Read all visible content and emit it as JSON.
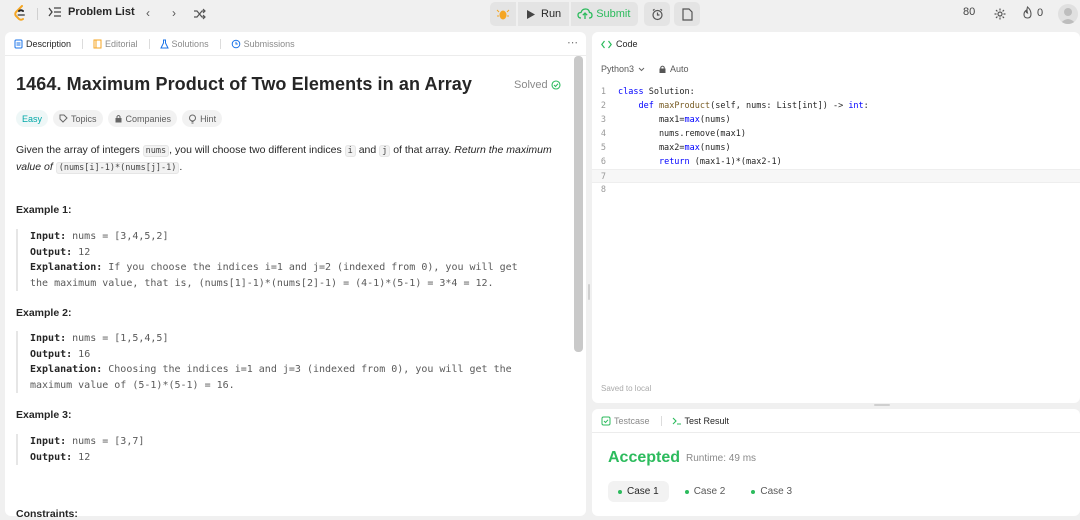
{
  "topbar": {
    "title": "Problem List",
    "run_label": "Run",
    "submit_label": "Submit",
    "points": "80",
    "streak": "0",
    "accent": "#2cbb5d"
  },
  "left_tabs": [
    {
      "label": "Description",
      "icon": "document-icon"
    },
    {
      "label": "Editorial",
      "icon": "book-icon"
    },
    {
      "label": "Solutions",
      "icon": "flask-icon"
    },
    {
      "label": "Submissions",
      "icon": "history-icon"
    }
  ],
  "problem": {
    "title": "1464. Maximum Product of Two Elements in an Array",
    "status": "Solved",
    "difficulty": "Easy",
    "tags": [
      "Topics",
      "Companies",
      "Hint"
    ],
    "desc_1": "Given the array of integers",
    "desc_code_1": "nums",
    "desc_2": ", you will choose two different indices",
    "desc_code_2": "i",
    "desc_3": "and",
    "desc_code_3": "j",
    "desc_4": "of that array.",
    "desc_italic": "Return the maximum value of",
    "desc_code_4": "(nums[i]-1)*(nums[j]-1)",
    "desc_end": ".",
    "examples": [
      {
        "heading": "Example 1:",
        "input_label": "Input:",
        "input": " nums = [3,4,5,2]",
        "output_label": "Output:",
        "output": " 12",
        "expl_label": "Explanation:",
        "expl_1": " If you choose the indices i=1 and j=2 (indexed from 0), you will get",
        "expl_2": "the maximum value, that is, (nums[1]-1)*(nums[2]-1) = (4-1)*(5-1) = 3*4 = 12."
      },
      {
        "heading": "Example 2:",
        "input_label": "Input:",
        "input": " nums = [1,5,4,5]",
        "output_label": "Output:",
        "output": " 16",
        "expl_label": "Explanation:",
        "expl_1": " Choosing the indices i=1 and j=3 (indexed from 0), you will get the",
        "expl_2": "maximum value of (5-1)*(5-1) = 16."
      },
      {
        "heading": "Example 3:",
        "input_label": "Input:",
        "input": " nums = [3,7]",
        "output_label": "Output:",
        "output": " 12"
      }
    ],
    "constraints_heading": "Constraints:"
  },
  "editor": {
    "tab_label": "Code",
    "language": "Python3",
    "mode": "Auto",
    "saved_text": "Saved to local",
    "line_numbers": [
      "1",
      "2",
      "3",
      "4",
      "5",
      "6",
      "7",
      "8"
    ],
    "code": {
      "l1_kw": "class",
      "l1_rest": " Solution:",
      "l2_indent": "    ",
      "l2_kw": "def",
      "l2_fn": " maxProduct",
      "l2_rest": "(self, nums: List[int]) -> ",
      "l2_type": "int",
      "l2_end": ":",
      "l3_a": "        max1=",
      "l3_b": "max",
      "l3_c": "(nums)",
      "l4": "        nums.remove(max1)",
      "l5_a": "        max2=",
      "l5_b": "max",
      "l5_c": "(nums)",
      "l6_a": "        ",
      "l6_kw": "return",
      "l6_c": " (max1-1)*(max2-1)"
    }
  },
  "results": {
    "tab_testcase": "Testcase",
    "tab_result": "Test Result",
    "verdict": "Accepted",
    "runtime": "Runtime: 49 ms",
    "cases": [
      "Case 1",
      "Case 2",
      "Case 3"
    ]
  }
}
